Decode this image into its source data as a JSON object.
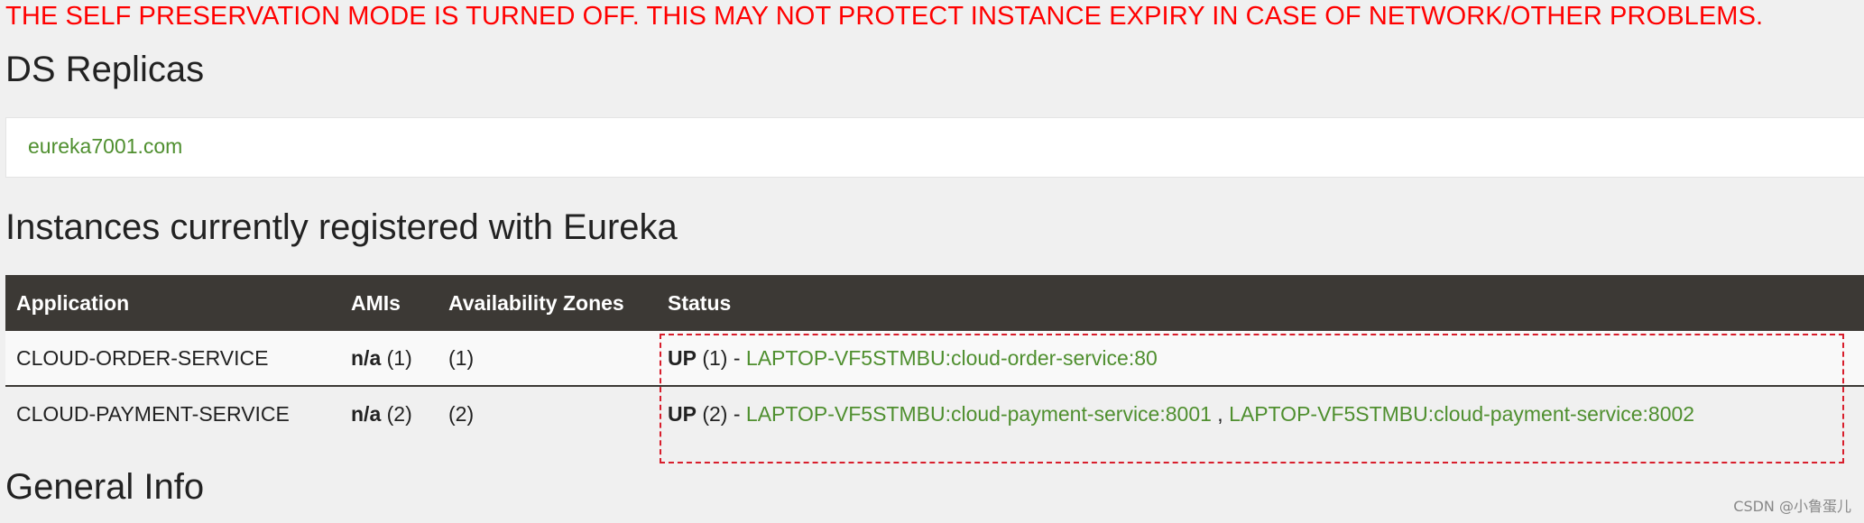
{
  "warning": "THE SELF PRESERVATION MODE IS TURNED OFF. THIS MAY NOT PROTECT INSTANCE EXPIRY IN CASE OF NETWORK/OTHER PROBLEMS.",
  "replicas": {
    "title": "DS Replicas",
    "items": [
      "eureka7001.com"
    ]
  },
  "instances": {
    "title": "Instances currently registered with Eureka",
    "headers": [
      "Application",
      "AMIs",
      "Availability Zones",
      "Status"
    ],
    "rows": [
      {
        "application": "CLOUD-ORDER-SERVICE",
        "ami_label": "n/a",
        "ami_count": "(1)",
        "zones": "(1)",
        "status": "UP",
        "status_count": "(1) -",
        "links": [
          "LAPTOP-VF5STMBU:cloud-order-service:80"
        ]
      },
      {
        "application": "CLOUD-PAYMENT-SERVICE",
        "ami_label": "n/a",
        "ami_count": "(2)",
        "zones": "(2)",
        "status": "UP",
        "status_count": "(2) -",
        "links": [
          "LAPTOP-VF5STMBU:cloud-payment-service:8001",
          "LAPTOP-VF5STMBU:cloud-payment-service:8002"
        ],
        "separator": ","
      }
    ]
  },
  "general": {
    "title": "General Info"
  },
  "watermark": "CSDN @小鲁蛋儿",
  "colors": {
    "warning": "#ff0000",
    "link": "#4f8f2f",
    "table_header_bg": "#3c3935",
    "highlight_border": "#d81e2c"
  }
}
